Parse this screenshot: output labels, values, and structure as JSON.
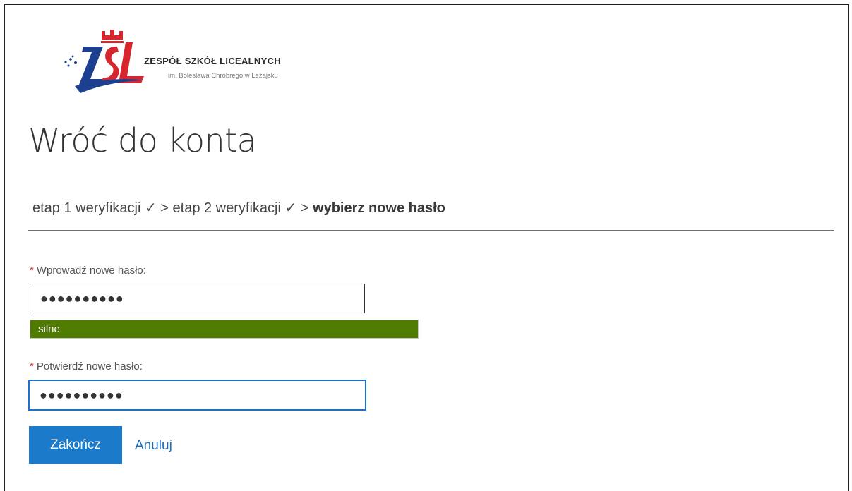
{
  "logo": {
    "monogram": "ZSL",
    "name": "ZESPÓŁ SZKÓŁ LICEALNYCH",
    "subtitle": "im. Bolesława Chrobrego w Leżajsku",
    "colors": {
      "red": "#d7262d",
      "blue": "#1d3f8f"
    }
  },
  "page": {
    "title": "Wróć do konta"
  },
  "steps": {
    "step1": "etap 1 weryfikacji ✓",
    "sep1": " > ",
    "step2": "etap 2 weryfikacji ✓",
    "sep2": " > ",
    "current": "wybierz nowe hasło"
  },
  "form": {
    "required_marker": "*",
    "new_password": {
      "label": "Wprowadź nowe hasło:",
      "value": "●●●●●●●●●●"
    },
    "strength": {
      "label": "silne",
      "color": "#4f7c00"
    },
    "confirm_password": {
      "label": "Potwierdź nowe hasło:",
      "value": "●●●●●●●●●●"
    }
  },
  "actions": {
    "finish_label": "Zakończ",
    "cancel_label": "Anuluj",
    "primary_color": "#1b7ac9"
  }
}
